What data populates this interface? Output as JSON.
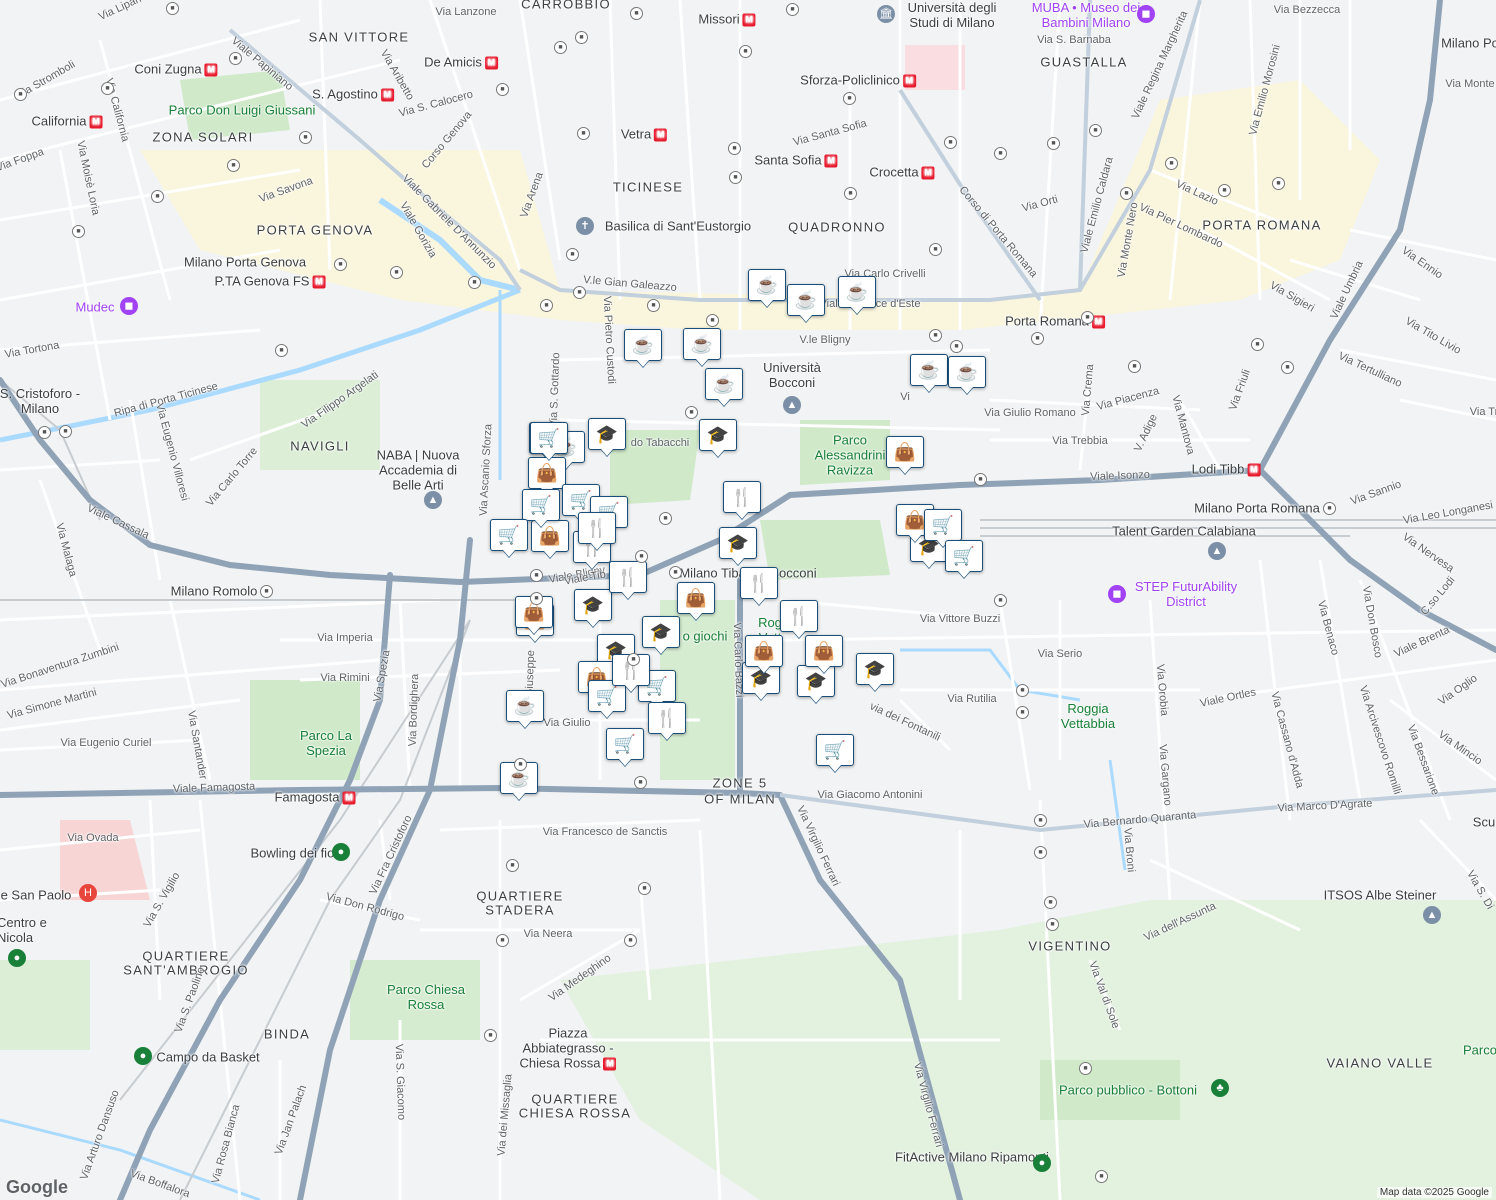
{
  "map": {
    "districts": [
      "SAN VITTORE",
      "CARROBBIO",
      "GUASTALLA",
      "ZONA SOLARI",
      "PORTA GENOVA",
      "TICINESE",
      "QUADRONNO",
      "PORTA ROMANA",
      "NAVIGLI",
      "ZONE 5",
      "OF MILAN",
      "QUARTIERE",
      "STADERA",
      "QUARTIERE",
      "SANT'AMBROGIO",
      "BINDA",
      "VIGENTINO",
      "VAIANO VALLE",
      "QUARTIERE",
      "CHIESA ROSSA"
    ],
    "streets": [
      "Via Lanzone",
      "Via Lipari",
      "Viale Papiniano",
      "Via Stromboli",
      "Via California",
      "Via Moisè Loria",
      "Via Foppa",
      "Via Aribetto",
      "Via S. Calocero",
      "Via Savona",
      "Viale Gorizia",
      "Corso Genova",
      "Via Arena",
      "Viale Gabriele D'Annunzio",
      "V.le Gian Galeazzo",
      "Via Pietro Custodi",
      "Via Santa Sofia",
      "Via Carlo Crivelli",
      "Corso di Porta Romana",
      "Via Orti",
      "Viale Emilio Caldara",
      "Via Monte Nero",
      "Viale Regina Margherita",
      "Via Emilio Morosini",
      "Via Bezzecca",
      "Via S. Barnaba",
      "Via Lazio",
      "Via Pier Lombardo",
      "Via Sigieri",
      "Via Ennio",
      "Via Tito Livio",
      "Via Tertulliano",
      "Viale Umbria",
      "Viale Beatrice d'Este",
      "V.le Bligny",
      "Via Giulio Romano",
      "Via Crema",
      "Via Piacenza",
      "V. Adige",
      "Via Mantova",
      "Via Friuli",
      "Via Trebbia",
      "Viale Isonzo",
      "Via Tortona",
      "Ripa di Porta Ticinese",
      "Via Filippo Argelati",
      "Via Eugenio Villoresi",
      "Via Carlo Torre",
      "Via Ascanio Sforza",
      "Via S. Gottardo",
      "do Tabacchi",
      "Viale Cassala",
      "Via Malaga",
      "Viale Bligny",
      "Via Imperia",
      "Via Rimini",
      "Via Bonaventura Zumbini",
      "Via Simone Martini",
      "Via Eugenio Curiel",
      "Via Santander",
      "Via Spezia",
      "Via Bordighera",
      "Via Giuseppe",
      "Via Giulio",
      "Via Carlo Bazzi",
      "Via Vittore Buzzi",
      "Via Serio",
      "Via Rutilia",
      "via dei Fontanili",
      "Via Sannio",
      "Via Leo Longanesi",
      "Via Nervesa",
      "C.so Lodi",
      "Viale Brenta",
      "Via Oglio",
      "Viale Ortles",
      "Via Benaco",
      "Via Don Bosco",
      "Via Orobia",
      "Via Cassano d'Adda",
      "Via Arcivescovo Romilli",
      "Via Bessarione",
      "Via Mincio",
      "Via Gargano",
      "Via Marco D'Agrate",
      "Via Bernardo Quaranta",
      "Via Broni",
      "Viale Famagosta",
      "Via Giacomo Antonini",
      "Via Virgilio Ferrari",
      "Via Francesco de Sanctis",
      "Via Ovada",
      "Via Fra Cristoforo",
      "Via Don Rodrigo",
      "Via S. Vigilio",
      "Via Neera",
      "Via Medeghino",
      "Via S. Paolino",
      "Via S. Giacomo",
      "Via dei Missaglia",
      "Via Jan Palach",
      "Via Rosa Bianca",
      "Via Arturo Dansuso",
      "Via Boffalora",
      "Via dell'Assunta",
      "Via Val di Sole",
      "Via Virgilio Ferrari"
    ],
    "places": {
      "parks": [
        "Parco Don Luigi Giussani",
        "Parco Alessandrini Ravizza",
        "Parco La Spezia",
        "Parco Chiesa Rossa",
        "Parco pubblico - Bottoni",
        "Parco",
        "Roggia Vettabbia",
        "Rog Vett",
        "o giochi"
      ],
      "pois": [
        "Università degli Studi di Milano",
        "MUBA • Museo dei Bambini Milano",
        "Basilica di Sant'Eustorgio",
        "Università Bocconi",
        "NABA | Nuova Accademia di Belle Arti",
        "Mudec",
        "Talent Garden Calabiana",
        "STEP FuturAbility District",
        "Bowling dei fiori",
        "ITSOS Albe Steiner",
        "Campo da Basket",
        "FitActive Milano Ripamonti",
        "e San Paolo",
        "Centro e Nicola"
      ],
      "stations": [
        "Missori",
        "De Amicis",
        "S. Agostino",
        "Coni Zugna",
        "California",
        "Vetra",
        "Santa Sofia",
        "Sforza-Policlinico",
        "Crocetta",
        "Porta Romana",
        "Lodi Tibb",
        "Milano Porta Genova",
        "P.TA Genova FS",
        "Milano Romolo",
        "Milano Porta Romana",
        "Milano Tibaldi - Bocconi",
        "Famagosta",
        "Piazza Abbiategrasso - Chiesa Rossa",
        "S. Cristoforo - Milano",
        "Milano Po",
        "Via Monte",
        "Via Tr",
        "Scu",
        "Via S. Di",
        "Viale Tib",
        "Vi"
      ]
    },
    "footer": "Map data ©2025 Google",
    "logo": "Google",
    "marker_types": {
      "cafe": "coffee-cup-icon",
      "school": "graduation-cap-icon",
      "shop": "shopping-bag-icon",
      "grocery": "shopping-cart-icon",
      "restaurant": "fork-knife-icon"
    }
  }
}
